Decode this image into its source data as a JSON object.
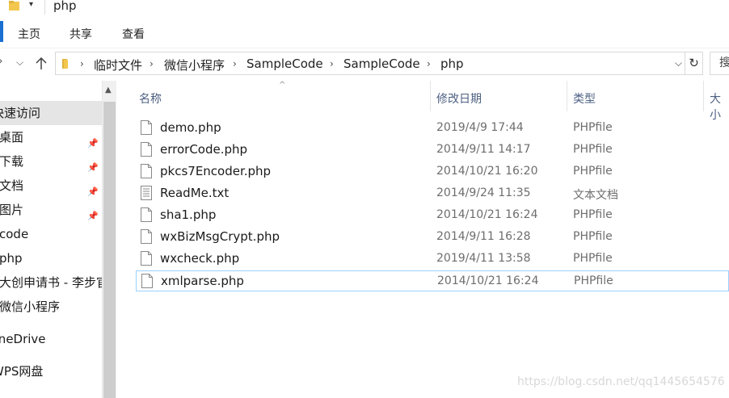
{
  "window": {
    "title": "php"
  },
  "ribbon": {
    "tabs": [
      "主页",
      "共享",
      "查看"
    ]
  },
  "address": {
    "crumbs": [
      "临时文件",
      "微信小程序",
      "SampleCode",
      "SampleCode",
      "php"
    ],
    "search_placeholder": "搜"
  },
  "sidebar": {
    "items": [
      {
        "label": "快速访问",
        "pinned": false,
        "selected": true
      },
      {
        "label": "桌面",
        "pinned": true
      },
      {
        "label": "下载",
        "pinned": true
      },
      {
        "label": "文档",
        "pinned": true
      },
      {
        "label": "图片",
        "pinned": true
      },
      {
        "label": "code",
        "pinned": false
      },
      {
        "label": "php",
        "pinned": false
      },
      {
        "label": "大创申请书 - 李步官",
        "pinned": false
      },
      {
        "label": "微信小程序",
        "pinned": false
      },
      {
        "label": "OneDrive",
        "pinned": false
      },
      {
        "label": "WPS网盘",
        "pinned": false
      }
    ]
  },
  "columns": {
    "name": "名称",
    "modified": "修改日期",
    "type": "类型",
    "size": "大小"
  },
  "files": [
    {
      "name": "demo.php",
      "modified": "2019/4/9 17:44",
      "type": "PHPfile"
    },
    {
      "name": "errorCode.php",
      "modified": "2014/9/11 14:17",
      "type": "PHPfile"
    },
    {
      "name": "pkcs7Encoder.php",
      "modified": "2014/10/21 16:20",
      "type": "PHPfile"
    },
    {
      "name": "ReadMe.txt",
      "modified": "2014/9/24 11:35",
      "type": "文本文档"
    },
    {
      "name": "sha1.php",
      "modified": "2014/10/21 16:24",
      "type": "PHPfile"
    },
    {
      "name": "wxBizMsgCrypt.php",
      "modified": "2014/9/11 16:28",
      "type": "PHPfile"
    },
    {
      "name": "wxcheck.php",
      "modified": "2019/4/11 13:58",
      "type": "PHPfile"
    },
    {
      "name": "xmlparse.php",
      "modified": "2014/10/21 16:24",
      "type": "PHPfile"
    }
  ],
  "watermark": "https://blog.csdn.net/qq1445654576",
  "colors": {
    "accent": "#1a6fd1",
    "selection": "#e5e5e5",
    "focus_border": "#99d1ff",
    "folder": "#f3c74d"
  },
  "icons": {
    "folder": "folder-icon",
    "pin": "pin-icon",
    "back": "back-arrow-icon",
    "forward": "forward-arrow-icon",
    "recent": "chevron-down-icon",
    "up": "up-arrow-icon",
    "refresh": "refresh-icon",
    "php_file": "blank-file-icon",
    "txt_file": "text-file-icon"
  }
}
